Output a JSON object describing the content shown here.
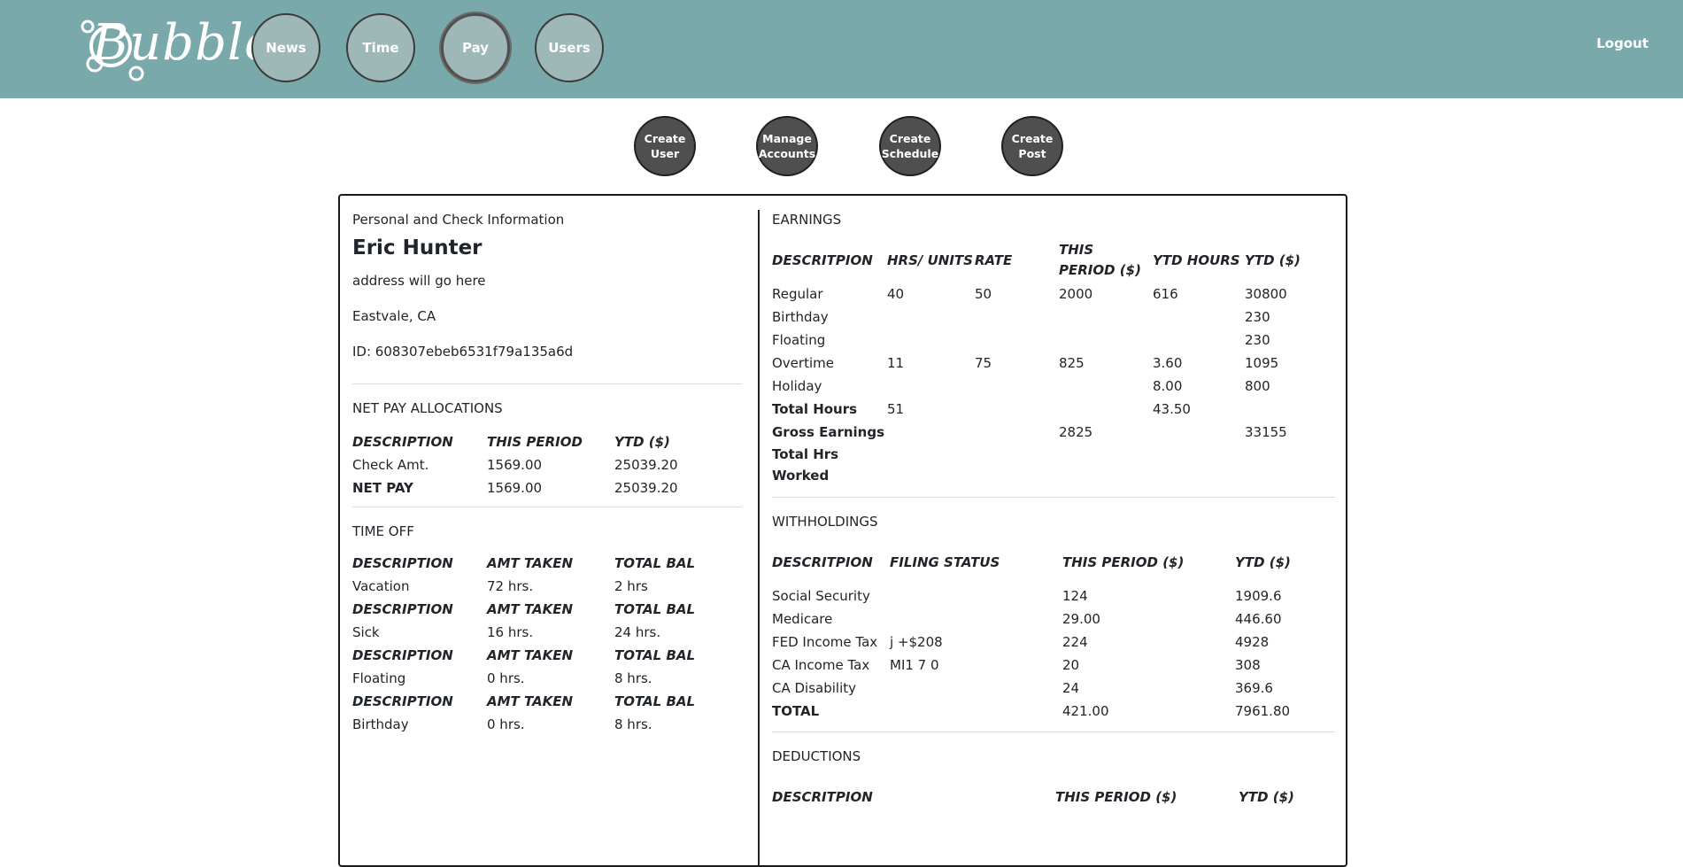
{
  "app": {
    "name": "Bubbles"
  },
  "nav": [
    {
      "label": "News"
    },
    {
      "label": "Time"
    },
    {
      "label": "Pay",
      "active": true
    },
    {
      "label": "Users"
    }
  ],
  "logout": "Logout",
  "actions": [
    {
      "line1": "Create",
      "line2": "User"
    },
    {
      "line1": "Manage",
      "line2": "Accounts"
    },
    {
      "line1": "Create",
      "line2": "Schedule"
    },
    {
      "line1": "Create",
      "line2": "Post"
    }
  ],
  "personal": {
    "title": "Personal and Check Information",
    "name": "Eric Hunter",
    "address": "address will go here",
    "city": "Eastvale, CA",
    "id": "ID: 608307ebeb6531f79a135a6d"
  },
  "netpay": {
    "title": "NET PAY ALLOCATIONS",
    "headers": [
      "DESCRIPTION",
      "THIS PERIOD",
      "YTD ($)"
    ],
    "rows": [
      [
        "Check Amt.",
        "1569.00",
        "25039.20"
      ],
      [
        "NET PAY",
        "1569.00",
        "25039.20"
      ]
    ]
  },
  "timeoff": {
    "title": "TIME OFF",
    "headers": [
      "DESCRIPTION",
      "AMT TAKEN",
      "TOTAL BAL"
    ],
    "rows": [
      [
        "Vacation",
        "72 hrs.",
        "2 hrs"
      ],
      [
        "Sick",
        "16 hrs.",
        "24 hrs."
      ],
      [
        "Floating",
        "0 hrs.",
        "8 hrs."
      ],
      [
        "Birthday",
        "0 hrs.",
        "8 hrs."
      ]
    ]
  },
  "earnings": {
    "title": "EARNINGS",
    "headers": [
      "DESCRITPION",
      "HRS/ UNITS",
      "RATE",
      "THIS PERIOD ($)",
      "YTD HOURS",
      "YTD ($)"
    ],
    "rows": [
      [
        "Regular",
        "40",
        "50",
        "2000",
        "616",
        "30800"
      ],
      [
        "Birthday",
        "",
        "",
        "",
        "",
        "230"
      ],
      [
        "Floating",
        "",
        "",
        "",
        "",
        "230"
      ],
      [
        "Overtime",
        "11",
        "75",
        "825",
        "3.60",
        "1095"
      ],
      [
        "Holiday",
        "",
        "",
        "",
        "8.00",
        "800"
      ],
      [
        "Total Hours",
        "51",
        "",
        "",
        "43.50",
        ""
      ],
      [
        "Gross Earnings",
        "",
        "",
        "2825",
        "",
        "33155"
      ],
      [
        "Total Hrs Worked",
        "",
        "",
        "",
        "",
        ""
      ]
    ]
  },
  "withholdings": {
    "title": "WITHHOLDINGS",
    "headers": [
      "DESCRITPION",
      "FILING STATUS",
      "THIS PERIOD ($)",
      "YTD ($)"
    ],
    "rows": [
      [
        "Social Security",
        "",
        "124",
        "1909.6"
      ],
      [
        "Medicare",
        "",
        "29.00",
        "446.60"
      ],
      [
        "FED Income Tax",
        "j +$208",
        "224",
        "4928"
      ],
      [
        "CA Income Tax",
        "MI1 7 0",
        "20",
        "308"
      ],
      [
        "CA Disability",
        "",
        "24",
        "369.6"
      ],
      [
        "TOTAL",
        "",
        "421.00",
        "7961.80"
      ]
    ]
  },
  "deductions": {
    "title": "DEDUCTIONS",
    "headers": [
      "DESCRITPION",
      "THIS PERIOD ($)",
      "YTD ($)"
    ]
  }
}
